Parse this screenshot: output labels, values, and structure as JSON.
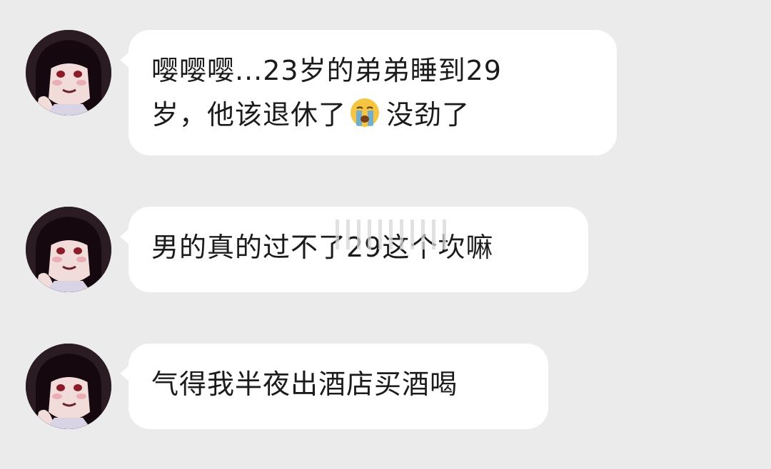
{
  "messages": [
    {
      "line1": "嘤嘤嘤...23岁的弟弟睡到29",
      "line2_before": "岁，他该退休了",
      "emoji": "loudly-crying-face-icon",
      "line2_after": "没劲了"
    },
    {
      "text": "男的真的过不了29这个坎嘛"
    },
    {
      "text": "气得我半夜出酒店买酒喝"
    }
  ]
}
